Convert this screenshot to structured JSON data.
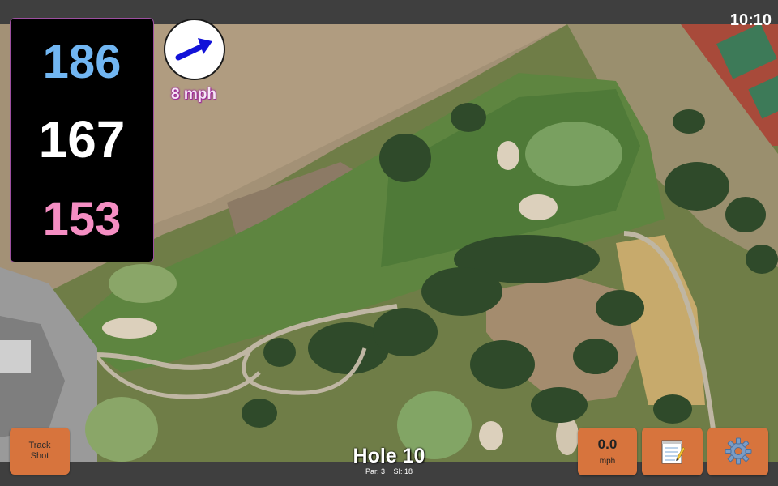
{
  "status_bar": {
    "time": "10:10"
  },
  "distances": {
    "back": "186",
    "middle": "167",
    "front": "153"
  },
  "wind": {
    "speed_label": "8 mph",
    "direction_icon": "arrow-right-icon"
  },
  "hole": {
    "title": "Hole 10",
    "par": "Par: 3",
    "stroke_index": "SI: 18"
  },
  "buttons": {
    "track_shot": "Track\nShot",
    "speed_value": "0.0",
    "speed_unit": "mph",
    "notes_icon": "notepad-icon",
    "settings_icon": "gear-icon"
  },
  "colors": {
    "back_distance": "#71b6f2",
    "middle_distance": "#ffffff",
    "front_distance": "#f58ec3",
    "button_orange": "#d7743d",
    "wind_arrow": "#1212d8"
  }
}
